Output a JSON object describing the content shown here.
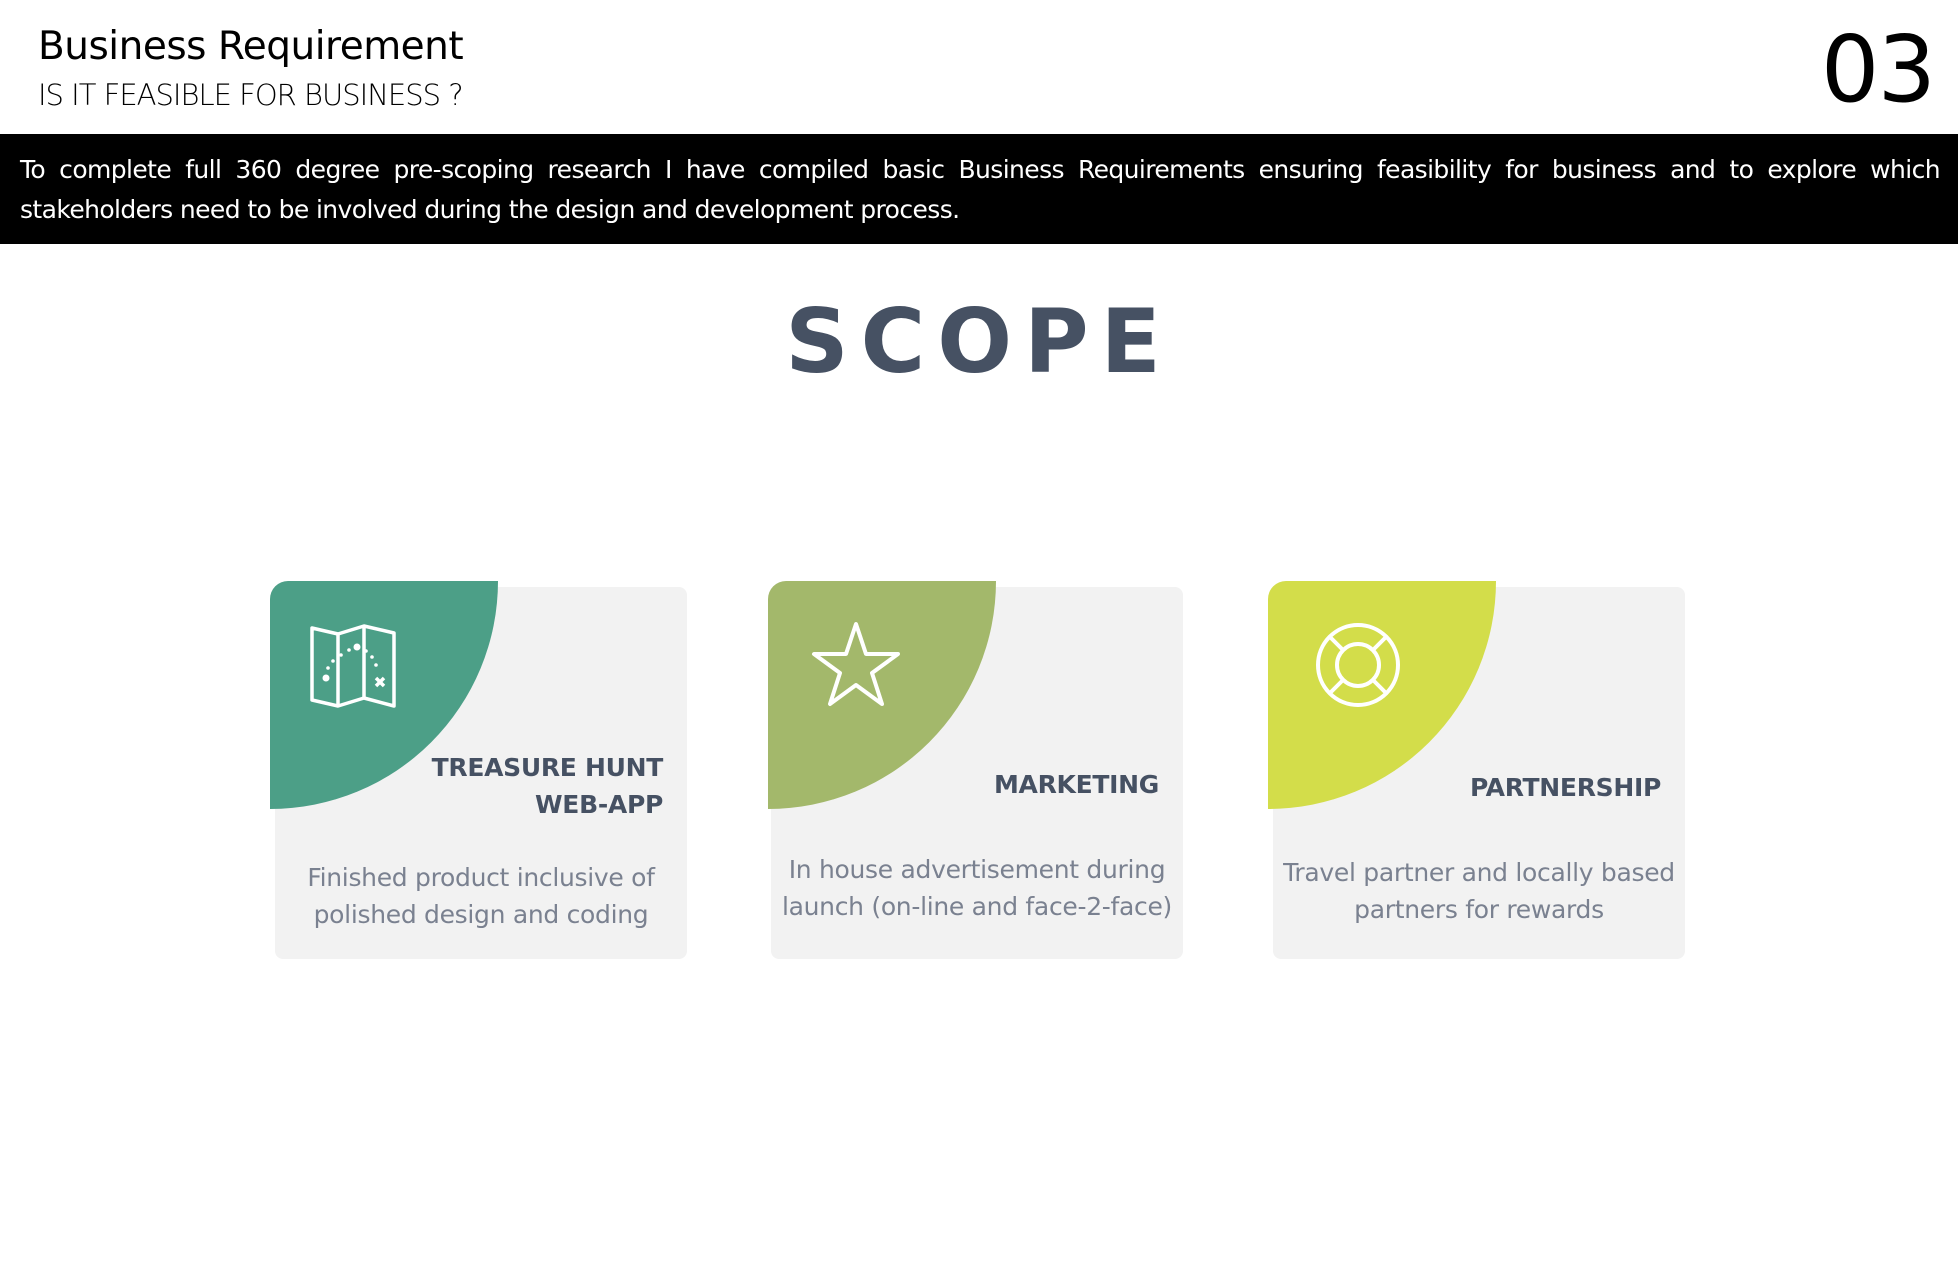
{
  "header": {
    "title": "Business Requirement",
    "subtitle": "IS IT FEASIBLE FOR BUSINESS ?",
    "page_number": "03"
  },
  "intro": "To complete full 360 degree pre-scoping research I have compiled basic Business Requirements ensuring feasibility for business and to explore which stakeholders need to be involved during the design and development process.",
  "section_title": "SCOPE",
  "cards": [
    {
      "title_lines": [
        "TREASURE HUNT",
        "WEB-APP"
      ],
      "description_lines": [
        "Finished product inclusive of",
        "polished design and coding"
      ],
      "icon": "map-icon",
      "color": "#4c9f87"
    },
    {
      "title_lines": [
        "MARKETING"
      ],
      "description_lines": [
        "In house advertisement  during",
        "launch (on-line and face-2-face)"
      ],
      "icon": "star-icon",
      "color": "#a3b86b"
    },
    {
      "title_lines": [
        "PARTNERSHIP"
      ],
      "description_lines": [
        "Travel partner and locally based",
        "partners for rewards"
      ],
      "icon": "lifebuoy-icon",
      "color": "#d3dd4a"
    }
  ]
}
